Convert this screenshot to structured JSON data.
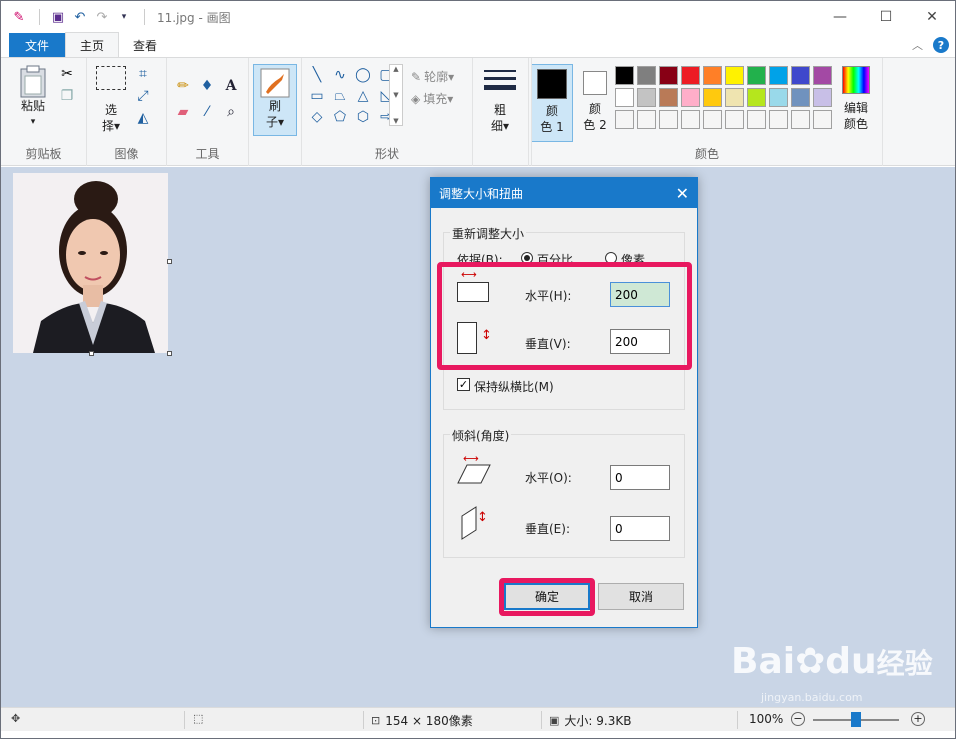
{
  "window": {
    "title": "11.jpg - 画图",
    "min_glyph": "—",
    "max_glyph": "☐",
    "close_glyph": "✕"
  },
  "qat": {
    "app_icon": "paint-palette-icon",
    "save_icon": "save-icon",
    "undo_icon": "undo-icon",
    "redo_icon": "redo-icon",
    "customize_icon": "dropdown-icon"
  },
  "tabs": {
    "file": "文件",
    "home": "主页",
    "view": "查看"
  },
  "ribbon": {
    "clipboard": {
      "paste": "粘贴",
      "label": "剪贴板"
    },
    "image": {
      "select_line1": "选",
      "select_line2": "择▾",
      "label": "图像"
    },
    "tools": {
      "label": "工具"
    },
    "brush": {
      "line1": "刷",
      "line2": "子▾"
    },
    "shapes": {
      "outline": "轮廓▾",
      "fill": "填充▾",
      "label": "形状"
    },
    "size": {
      "line1": "粗",
      "line2": "细▾"
    },
    "color1": {
      "line1": "颜",
      "line2": "色 1"
    },
    "color2": {
      "line1": "颜",
      "line2": "色 2"
    },
    "colors_label": "颜色",
    "edit_colors": {
      "line1": "编辑",
      "line2": "颜色"
    },
    "palette": [
      "#000000",
      "#7f7f7f",
      "#880015",
      "#ed1c24",
      "#ff7f27",
      "#fff200",
      "#22b14c",
      "#00a2e8",
      "#3f48cc",
      "#a349a4",
      "#ffffff",
      "#c3c3c3",
      "#b97a57",
      "#ffaec9",
      "#ffc90e",
      "#efe4b0",
      "#b5e61d",
      "#99d9ea",
      "#7092be",
      "#c8bfe7",
      "#f5f5f5",
      "#f5f5f5",
      "#f5f5f5",
      "#f5f5f5",
      "#f5f5f5",
      "#f5f5f5",
      "#f5f5f5",
      "#f5f5f5",
      "#f5f5f5",
      "#f5f5f5"
    ]
  },
  "dialog": {
    "title": "调整大小和扭曲",
    "resize_legend": "重新调整大小",
    "by_label": "依据(B):",
    "percent_label": "百分比",
    "pixels_label": "像素",
    "horizontal_label": "水平(H):",
    "horizontal_value": "200",
    "vertical_label": "垂直(V):",
    "vertical_value": "200",
    "keep_aspect_label": "保持纵横比(M)",
    "skew_legend": "倾斜(角度)",
    "skew_h_label": "水平(O):",
    "skew_h_value": "0",
    "skew_v_label": "垂直(E):",
    "skew_v_value": "0",
    "ok": "确定",
    "cancel": "取消"
  },
  "status": {
    "image_size": "154 × 180像素",
    "file_size": "大小: 9.3KB",
    "zoom": "100%",
    "zoom_minus": "−",
    "zoom_plus": "+"
  },
  "watermark": {
    "text": "Bai",
    "text2": "du",
    "text3": "经验",
    "sub": "jingyan.baidu.com"
  }
}
